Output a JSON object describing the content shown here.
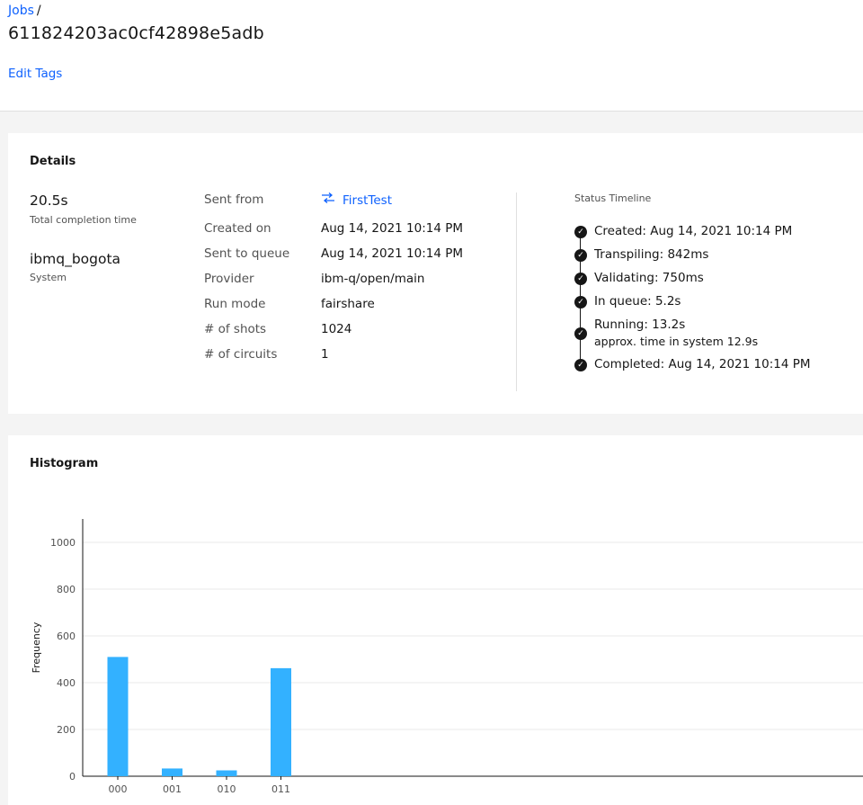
{
  "breadcrumb": {
    "jobs_label": "Jobs",
    "separator": "/"
  },
  "job": {
    "id": "611824203ac0cf42898e5adb",
    "edit_tags_label": "Edit Tags"
  },
  "details": {
    "title": "Details",
    "completion_time": {
      "value": "20.5s",
      "label": "Total completion time"
    },
    "system": {
      "value": "ibmq_bogota",
      "label": "System"
    },
    "fields": {
      "sent_from": {
        "label": "Sent from",
        "value": "FirstTest",
        "icon": "program-link-icon"
      },
      "created_on": {
        "label": "Created on",
        "value": "Aug 14, 2021 10:14 PM"
      },
      "sent_to_queue": {
        "label": "Sent to queue",
        "value": "Aug 14, 2021 10:14 PM"
      },
      "provider": {
        "label": "Provider",
        "value": "ibm-q/open/main"
      },
      "run_mode": {
        "label": "Run mode",
        "value": "fairshare"
      },
      "shots": {
        "label": "# of shots",
        "value": "1024"
      },
      "circuits": {
        "label": "# of circuits",
        "value": "1"
      }
    },
    "timeline": {
      "title": "Status Timeline",
      "items": [
        {
          "text": "Created: Aug 14, 2021 10:14 PM"
        },
        {
          "text": "Transpiling: 842ms"
        },
        {
          "text": "Validating: 750ms"
        },
        {
          "text": "In queue: 5.2s"
        },
        {
          "text": "Running: 13.2s",
          "sub": "approx. time in system 12.9s"
        },
        {
          "text": "Completed: Aug 14, 2021 10:14 PM"
        }
      ]
    }
  },
  "histogram": {
    "title": "Histogram"
  },
  "chart_data": {
    "type": "bar",
    "categories": [
      "000",
      "001",
      "010",
      "011"
    ],
    "values": [
      510,
      33,
      25,
      462
    ],
    "ylabel": "Frequency",
    "xlabel": "",
    "ylim": [
      0,
      1100
    ],
    "yticks": [
      0,
      200,
      400,
      600,
      800,
      1000
    ],
    "grid": true,
    "bar_color": "#33b1ff"
  },
  "colors": {
    "link": "#0f62fe",
    "bar": "#33b1ff",
    "text": "#161616",
    "muted": "#525252"
  }
}
